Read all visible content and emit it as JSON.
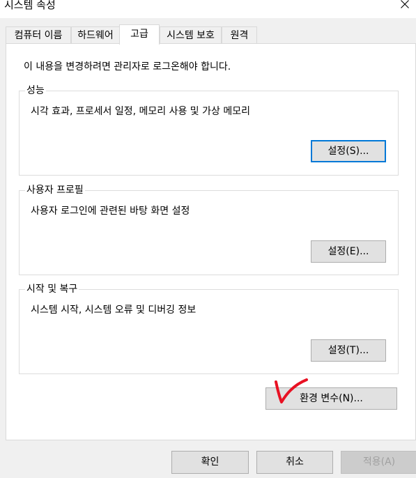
{
  "window": {
    "title": "시스템 속성",
    "close_icon": "close-icon"
  },
  "tabs": [
    {
      "label": "컴퓨터 이름",
      "active": false
    },
    {
      "label": "하드웨어",
      "active": false
    },
    {
      "label": "고급",
      "active": true
    },
    {
      "label": "시스템 보호",
      "active": false
    },
    {
      "label": "원격",
      "active": false
    }
  ],
  "advanced": {
    "intro": "이 내용을 변경하려면 관리자로 로그온해야 합니다.",
    "performance": {
      "title": "성능",
      "description": "시각 효과, 프로세서 일정, 메모리 사용 및 가상 메모리",
      "button": "설정(S)..."
    },
    "user_profiles": {
      "title": "사용자 프로필",
      "description": "사용자 로그인에 관련된 바탕 화면 설정",
      "button": "설정(E)..."
    },
    "startup_recovery": {
      "title": "시작 및 복구",
      "description": "시스템 시작, 시스템 오류 및 디버깅 정보",
      "button": "설정(T)..."
    },
    "env_vars_button": "환경 변수(N)...",
    "annotation_color": "#e81123"
  },
  "footer": {
    "ok": "확인",
    "cancel": "취소",
    "apply": "적용(A)",
    "apply_enabled": false
  }
}
